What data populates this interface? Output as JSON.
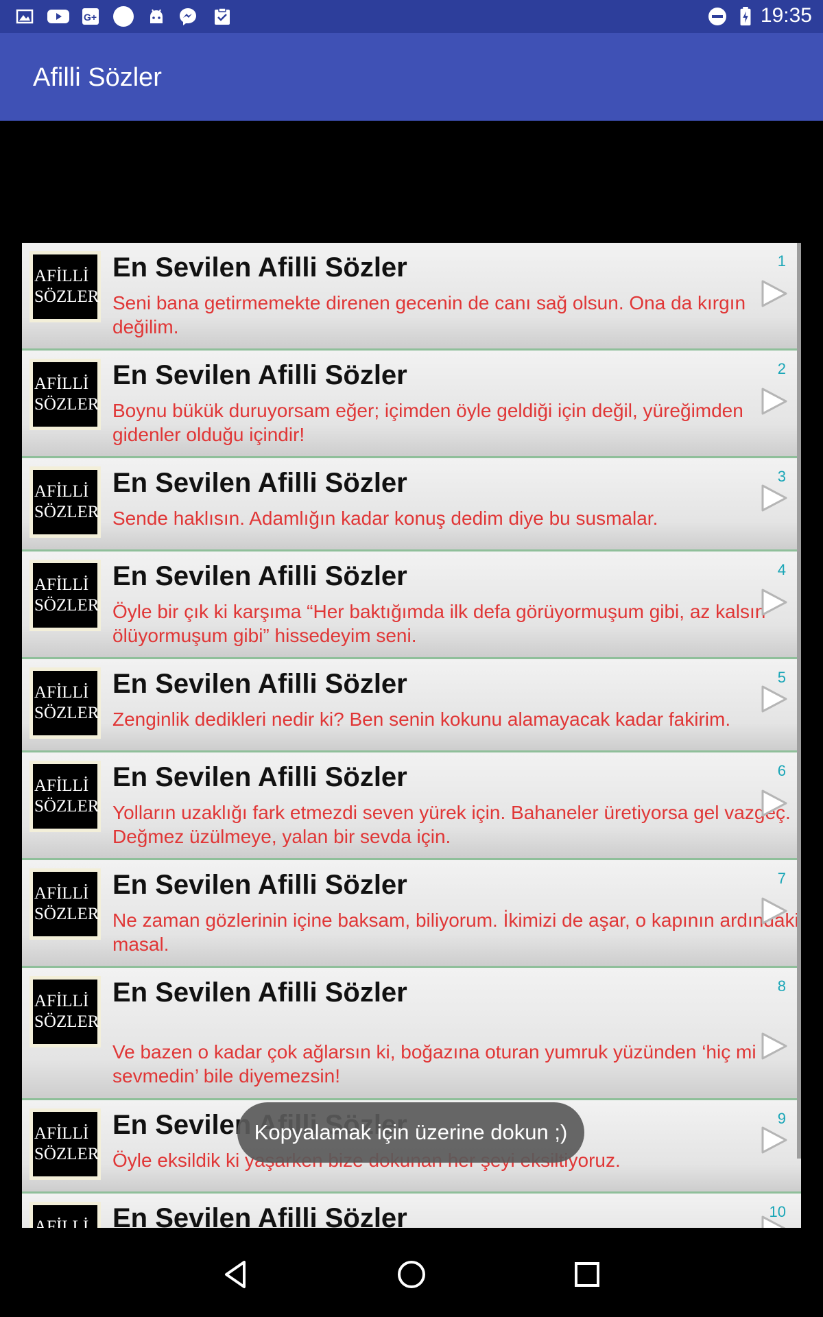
{
  "status_bar": {
    "time": "19:35",
    "icons": [
      "image-icon",
      "youtube-icon",
      "google-plus-icon",
      "circle-icon",
      "android-icon",
      "messenger-icon",
      "clipboard-check-icon",
      "do-not-disturb-icon",
      "battery-charging-icon"
    ]
  },
  "app_bar": {
    "title": "Afilli Sözler"
  },
  "list": {
    "thumb_line1": "AFİLLİ",
    "thumb_line2": "SÖZLER",
    "items": [
      {
        "number": "1",
        "title": "En Sevilen Afilli Sözler",
        "quote": "Seni bana getirmemekte direnen gecenin de canı sağ olsun. Ona da kırgın değilim."
      },
      {
        "number": "2",
        "title": "En Sevilen Afilli Sözler",
        "quote": "Boynu bükük duruyorsam eğer; içimden öyle geldiği için değil, yüreğimden gidenler olduğu içindir!"
      },
      {
        "number": "3",
        "title": "En Sevilen Afilli Sözler",
        "quote": "Sende haklısın. Adamlığın kadar konuş dedim diye bu susmalar."
      },
      {
        "number": "4",
        "title": "En Sevilen Afilli Sözler",
        "quote": "Öyle bir çık ki karşıma “Her baktığımda ilk defa görüyormuşum gibi, az kalsın ölüyormuşum gibi” hissedeyim seni."
      },
      {
        "number": "5",
        "title": "En Sevilen Afilli Sözler",
        "quote": "Zenginlik dedikleri nedir ki? Ben senin kokunu alamayacak kadar fakirim."
      },
      {
        "number": "6",
        "title": "En Sevilen Afilli Sözler",
        "quote": "Yolların uzaklığı fark etmezdi seven yürek için. Bahaneler üretiyorsa gel vazgeç. Değmez üzülmeye, yalan bir sevda için."
      },
      {
        "number": "7",
        "title": "En Sevilen Afilli Sözler",
        "quote": "Ne zaman gözlerinin içine baksam, biliyorum. İkimizi de aşar, o kapının ardındaki masal."
      },
      {
        "number": "8",
        "title": "En Sevilen Afilli Sözler",
        "quote": "Ve bazen o kadar çok ağlarsın ki, boğazına oturan yumruk yüzünden ‘hiç mi sevmedin’ bile diyemezsin!"
      },
      {
        "number": "9",
        "title": "En Sevilen Afilli Sözler",
        "quote": "Öyle eksildik ki yaşarken bize dokunan her şeyi eksiltiyoruz."
      },
      {
        "number": "10",
        "title": "En Sevilen Afilli Sözler",
        "quote": ""
      }
    ]
  },
  "toast": {
    "text": "Kopyalamak için üzerine dokun ;)"
  },
  "nav_bar": {
    "buttons": [
      "back-icon",
      "home-icon",
      "recents-icon"
    ]
  }
}
